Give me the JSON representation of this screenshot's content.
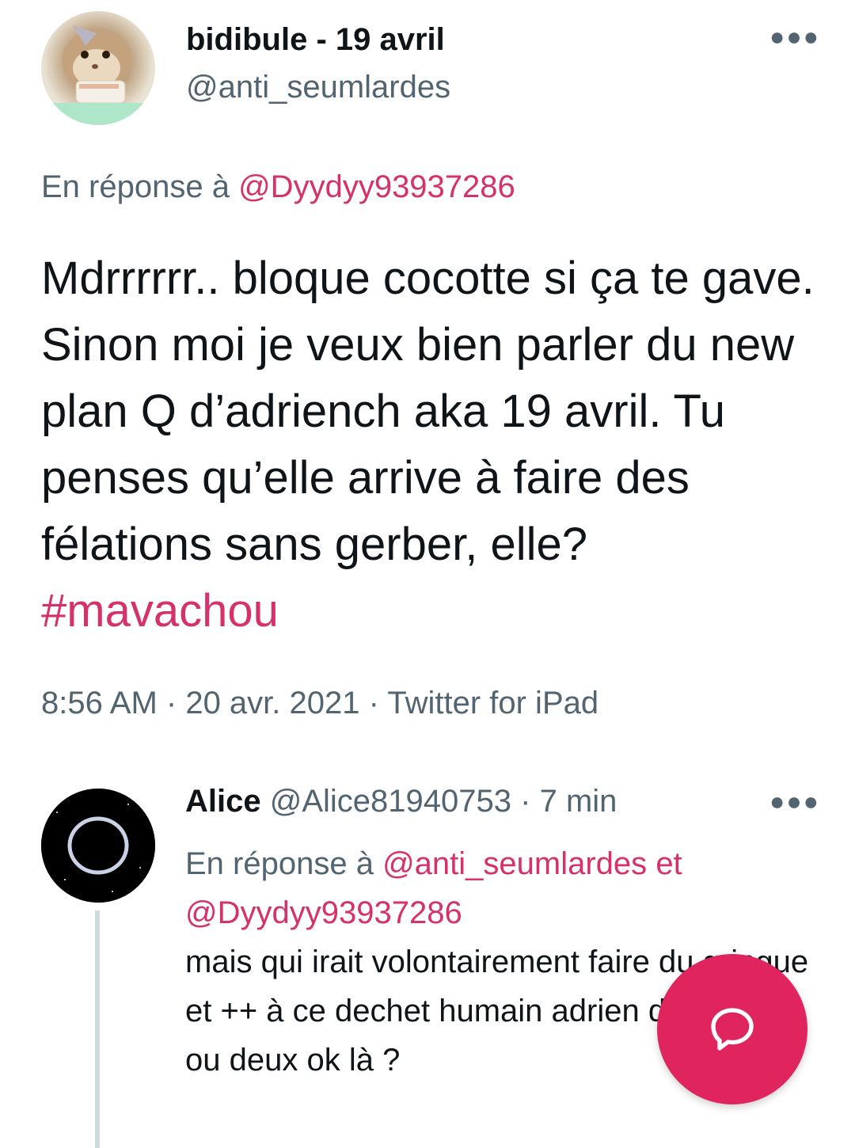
{
  "tweet": {
    "author_name": "bidibule",
    "author_date": "19 avril",
    "author_handle": "@anti_seumlardes",
    "more_icon": "more-horizontal-icon",
    "reply_prefix": "En réponse à",
    "reply_to": "@Dyydyy93937286",
    "text_main": "Mdrrrrrr.. bloque cocotte si ça te gave. Sinon moi je veux bien parler du new plan Q d’adriench aka 19 avril. Tu penses qu’elle arrive à faire des félations sans gerber, elle?",
    "hashtag": "#mavachou",
    "time": "8:56 AM",
    "date": "20 avr. 2021",
    "source": "Twitter for iPad"
  },
  "reply": {
    "name": "Alice",
    "handle": "@Alice81940753",
    "age": "7 min",
    "more_icon": "more-horizontal-icon",
    "reply_prefix": "En réponse à",
    "reply_to_1": "@anti_seumlardes",
    "conj": "et",
    "reply_to_2": "@Dyydyy93937286",
    "text": "mais qui irait volontairement faire du gringue et ++ à ce dechet humain adrien d'y a un an ou deux ok là ?"
  },
  "fab": {
    "icon": "compose-reply-icon",
    "color": "#e0245e"
  },
  "colors": {
    "link": "#d5316b",
    "secondary_text": "#536471",
    "primary_text": "#0f1419"
  }
}
